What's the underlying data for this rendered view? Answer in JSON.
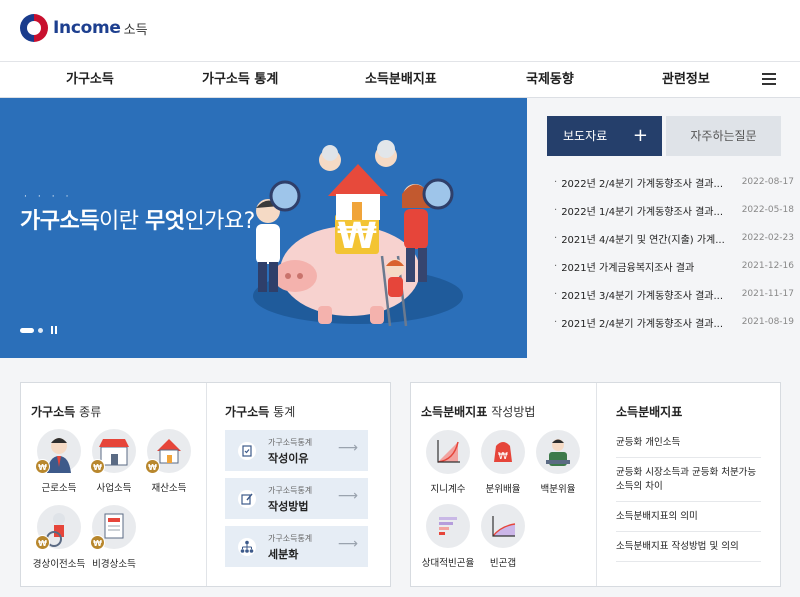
{
  "header": {
    "logo_text": "Income",
    "logo_sub": "소득"
  },
  "gnb": {
    "items": [
      "가구소득",
      "가구소득 통계",
      "소득분배지표",
      "국제동향",
      "관련정보"
    ]
  },
  "hero": {
    "title_part1": "가구소득",
    "title_part2": "이란 ",
    "title_part3": "무엇",
    "title_part4": "인가요?",
    "dots": "····"
  },
  "news": {
    "tab_active": "보도자료",
    "tab_inactive": "자주하는질문",
    "items": [
      {
        "title": "2022년 2/4분기 가계동향조사 결과...",
        "date": "2022-08-17"
      },
      {
        "title": "2022년 1/4분기 가계동향조사 결과...",
        "date": "2022-05-18"
      },
      {
        "title": "2021년 4/4분기 및 연간(지출) 가계...",
        "date": "2022-02-23"
      },
      {
        "title": "2021년 가계금융복지조사 결과",
        "date": "2021-12-16"
      },
      {
        "title": "2021년 3/4분기 가계동향조사 결과...",
        "date": "2021-11-17"
      },
      {
        "title": "2021년 2/4분기 가계동향조사 결과...",
        "date": "2021-08-19"
      }
    ]
  },
  "types": {
    "title": "가구소득",
    "title_sub": "종류",
    "items": [
      "근로소득",
      "사업소득",
      "재산소득",
      "경상이전소득",
      "비경상소득"
    ]
  },
  "stats": {
    "title": "가구소득",
    "title_sub": "통계",
    "buttons": [
      {
        "sub": "가구소득통계",
        "main": "작성이유"
      },
      {
        "sub": "가구소득통계",
        "main": "작성방법"
      },
      {
        "sub": "가구소득통계",
        "main": "세분화"
      }
    ]
  },
  "method": {
    "title": "소득분배지표",
    "title_sub": "작성방법",
    "items": [
      "지니계수",
      "분위배율",
      "백분위율",
      "상대적빈곤율",
      "빈곤갭"
    ]
  },
  "indicator": {
    "title": "소득분배지표",
    "links": [
      "균등화 개인소득",
      "균등화 시장소득과 균등화 처분가능소득의 차이",
      "소득분배지표의 의미",
      "소득분배지표 작성방법 및 의의"
    ]
  },
  "colors": {
    "brand_blue": "#1d3f8f",
    "hero_bg": "#2b6fb9",
    "tab_active_bg": "#253f6b",
    "won_gold": "#b8872d"
  }
}
